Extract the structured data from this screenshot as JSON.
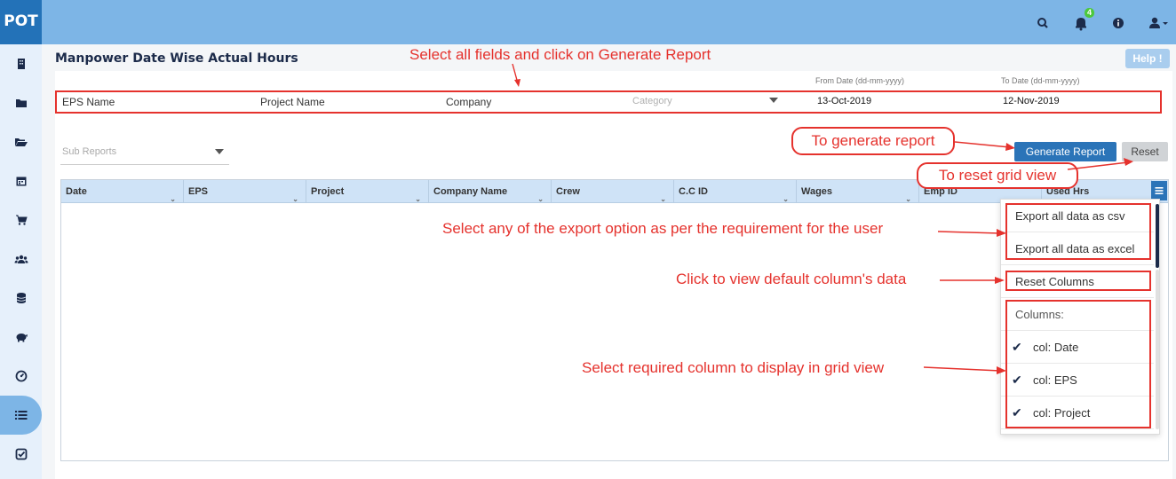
{
  "app": {
    "logo": "POT"
  },
  "topbar": {
    "notifications_count": "4"
  },
  "page": {
    "title": "Manpower Date Wise Actual Hours",
    "help_label": "Help !"
  },
  "filters": {
    "eps_name": "EPS Name",
    "project_name": "Project Name",
    "company": "Company",
    "category_placeholder": "Category",
    "from_date_label": "From Date (dd-mm-yyyy)",
    "from_date_value": "13-Oct-2019",
    "to_date_label": "To Date (dd-mm-yyyy)",
    "to_date_value": "12-Nov-2019",
    "sub_reports_placeholder": "Sub Reports"
  },
  "actions": {
    "generate_label": "Generate Report",
    "reset_label": "Reset"
  },
  "grid": {
    "columns": [
      "Date",
      "EPS",
      "Project",
      "Company Name",
      "Crew",
      "C.C ID",
      "Wages",
      "Emp ID",
      "Used Hrs"
    ]
  },
  "column_menu": {
    "export_csv": "Export all data as csv",
    "export_excel": "Export all data as excel",
    "reset_columns": "Reset Columns",
    "columns_header": "Columns:",
    "column_items": [
      "col: Date",
      "col: EPS",
      "col: Project"
    ]
  },
  "annotations": {
    "select_fields": "Select all fields and click on Generate Report",
    "generate": "To generate report",
    "reset": "To reset grid view",
    "export": "Select any of the export option as per the requirement for the user",
    "reset_columns": "Click to view default column's data",
    "select_columns": "Select required column to display in grid view"
  },
  "colors": {
    "accent": "#2b74b8",
    "topbar": "#7db5e6",
    "annotation": "#e5322d"
  },
  "icons": {
    "topbar": [
      "search-icon",
      "bell-icon",
      "info-icon",
      "user-icon"
    ],
    "sidebar": [
      "building-icon",
      "folder-icon",
      "folder-open-icon",
      "calendar-icon",
      "cart-icon",
      "users-icon",
      "database-icon",
      "piggy-bank-icon",
      "dashboard-icon",
      "list-icon",
      "check-square-icon"
    ]
  }
}
